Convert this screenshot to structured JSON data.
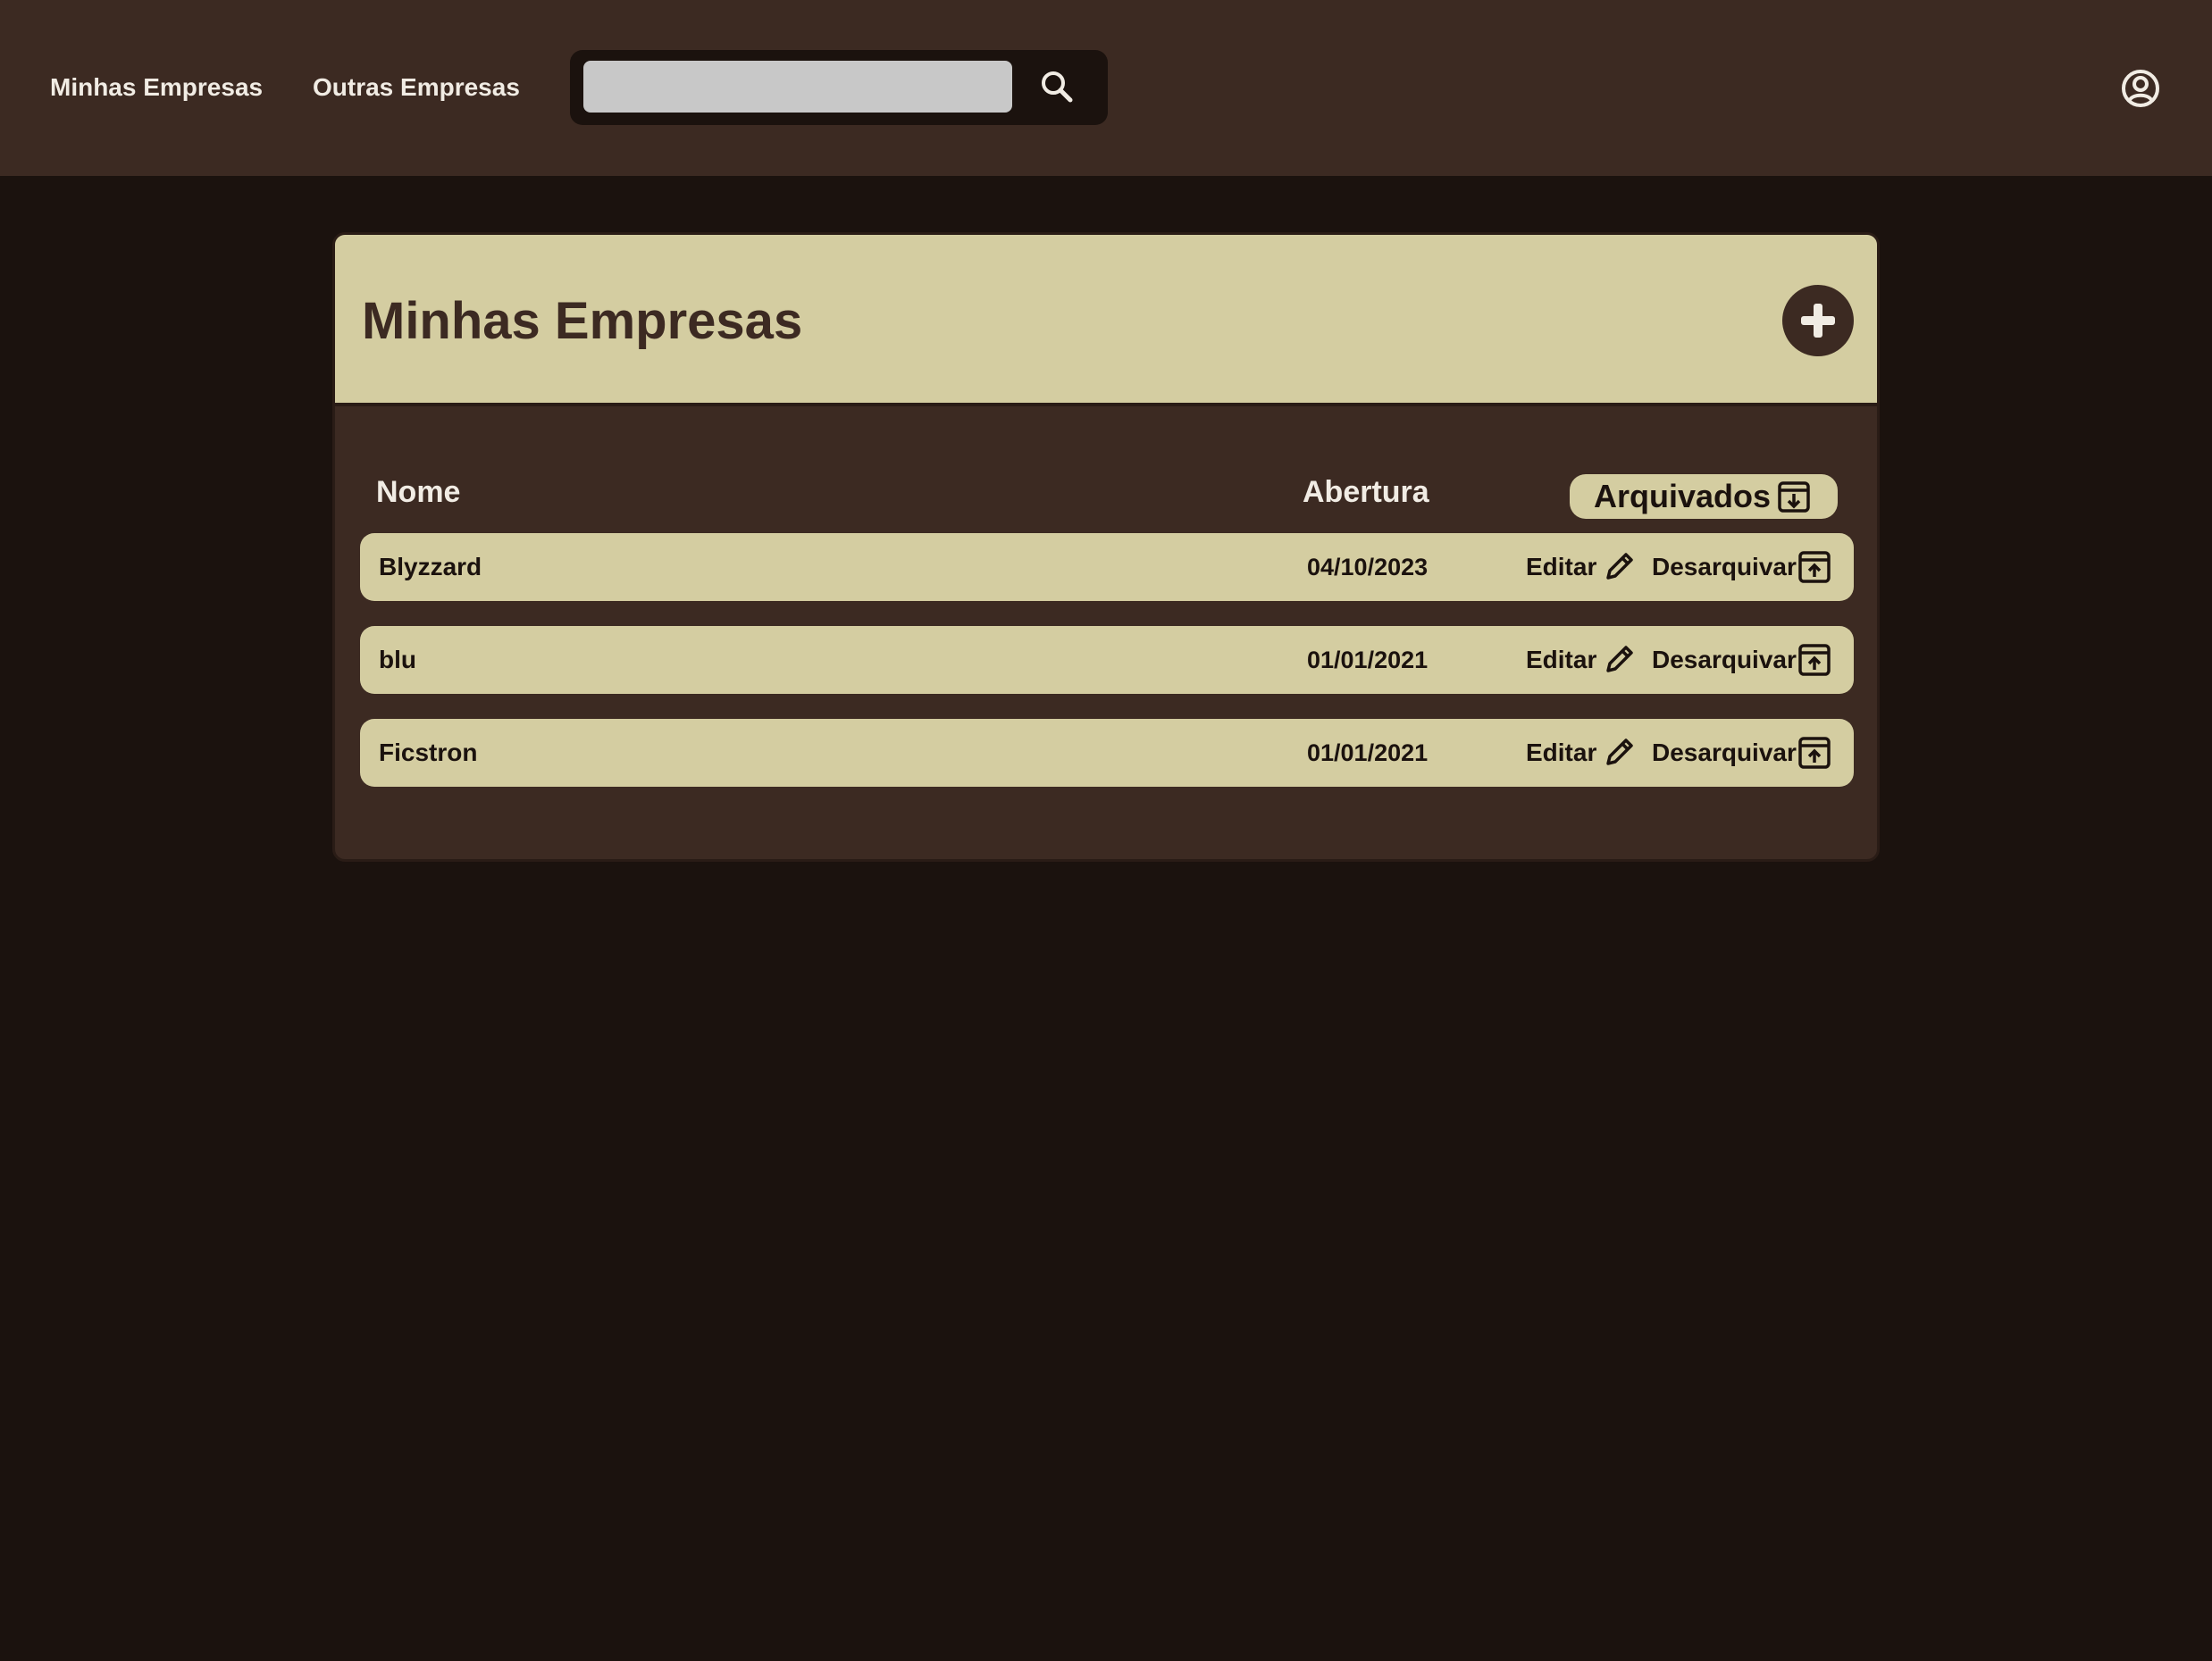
{
  "nav": {
    "links": [
      {
        "label": "Minhas Empresas"
      },
      {
        "label": "Outras Empresas"
      }
    ],
    "search": {
      "value": "",
      "placeholder": "",
      "icon": "search-icon"
    },
    "account_icon": "account-circle-icon"
  },
  "panel": {
    "title": "Minhas Empresas",
    "add_icon": "plus-icon",
    "columns": {
      "name": "Nome",
      "opening": "Abertura"
    },
    "archived_button": {
      "label": "Arquivados",
      "icon": "archive-download-icon"
    },
    "rows": [
      {
        "name": "Blyzzard",
        "date": "04/10/2023",
        "edit_label": "Editar",
        "unarchive_label": "Desarquivar"
      },
      {
        "name": "blu",
        "date": "01/01/2021",
        "edit_label": "Editar",
        "unarchive_label": "Desarquivar"
      },
      {
        "name": "Ficstron",
        "date": "01/01/2021",
        "edit_label": "Editar",
        "unarchive_label": "Desarquivar"
      }
    ]
  },
  "colors": {
    "background": "#1b120e",
    "header": "#3c2a22",
    "accent": "#d4cda1",
    "search_field": "#c8c8c8",
    "text_light": "#f1ece4"
  }
}
